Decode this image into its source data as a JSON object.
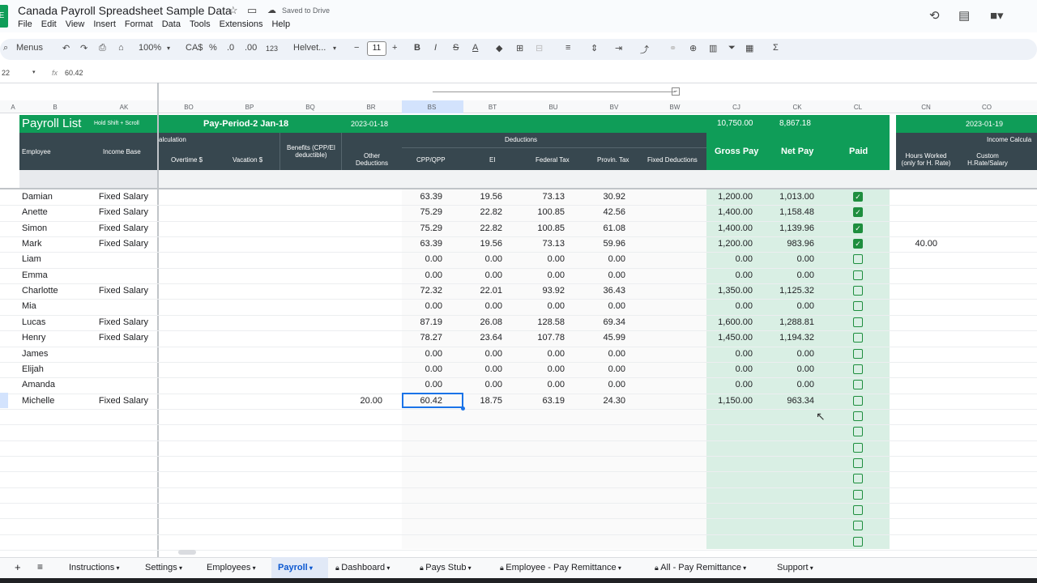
{
  "app": {
    "title": "Canada Payroll Spreadsheet Sample Data",
    "saved_status": "Saved to Drive",
    "logo_letter": "E"
  },
  "menu": [
    "File",
    "Edit",
    "View",
    "Insert",
    "Format",
    "Data",
    "Tools",
    "Extensions",
    "Help"
  ],
  "toolbar": {
    "menus_label": "Menus",
    "zoom": "100%",
    "currency": "CA$",
    "percent": "%",
    "dec_dec": ".0",
    "dec_inc": ".00",
    "number_format": "123",
    "font": "Helvet...",
    "font_size": "11",
    "bold": "B",
    "italic": "I",
    "strike": "S",
    "text_color": "A",
    "sum": "Σ"
  },
  "formula": {
    "cell_ref": "22",
    "fx": "fx",
    "value": "60.42"
  },
  "columns": [
    "A",
    "B",
    "AK",
    "BO",
    "BP",
    "BQ",
    "BR",
    "BS",
    "BT",
    "BU",
    "BV",
    "BW",
    "CJ",
    "CK",
    "CL",
    "CN",
    "CO"
  ],
  "header": {
    "payroll_list": "Payroll List",
    "hold_shift": "Hold Shift + Scroll",
    "pay_period": "Pay-Period-2 Jan-18",
    "period_date": "2023-01-18",
    "gross_total": "10,750.00",
    "net_total": "8,867.18",
    "next_date": "2023-01-19",
    "income_calc": "Income Calcula",
    "calculation": "alculation",
    "deductions": "Deductions",
    "employee": "Employee",
    "income_base": "Income Base",
    "overtime": "Overtime $",
    "vacation": "Vacation $",
    "benefits_1": "Benefits (CPP/EI",
    "benefits_2": "deductible)",
    "other_ded_1": "Other",
    "other_ded_2": "Deductions",
    "cpp": "CPP/QPP",
    "ei": "EI",
    "federal": "Federal Tax",
    "provin": "Provin. Tax",
    "fixed_ded": "Fixed Deductions",
    "gross_pay": "Gross Pay",
    "net_pay": "Net Pay",
    "paid": "Paid",
    "hours_1": "Hours Worked",
    "hours_2": "(only for H. Rate)",
    "custom_1": "Custom",
    "custom_2": "H.Rate/Salary"
  },
  "rows": [
    {
      "name": "Damian",
      "base": "Fixed Salary",
      "other": "",
      "cpp": "63.39",
      "ei": "19.56",
      "fed": "73.13",
      "prov": "30.92",
      "gross": "1,200.00",
      "net": "1,013.00",
      "paid": true,
      "hours": ""
    },
    {
      "name": "Anette",
      "base": "Fixed Salary",
      "other": "",
      "cpp": "75.29",
      "ei": "22.82",
      "fed": "100.85",
      "prov": "42.56",
      "gross": "1,400.00",
      "net": "1,158.48",
      "paid": true,
      "hours": ""
    },
    {
      "name": "Simon",
      "base": "Fixed Salary",
      "other": "",
      "cpp": "75.29",
      "ei": "22.82",
      "fed": "100.85",
      "prov": "61.08",
      "gross": "1,400.00",
      "net": "1,139.96",
      "paid": true,
      "hours": ""
    },
    {
      "name": "Mark",
      "base": "Fixed Salary",
      "other": "",
      "cpp": "63.39",
      "ei": "19.56",
      "fed": "73.13",
      "prov": "59.96",
      "gross": "1,200.00",
      "net": "983.96",
      "paid": true,
      "hours": "40.00"
    },
    {
      "name": "Liam",
      "base": "",
      "other": "",
      "cpp": "0.00",
      "ei": "0.00",
      "fed": "0.00",
      "prov": "0.00",
      "gross": "0.00",
      "net": "0.00",
      "paid": false,
      "hours": ""
    },
    {
      "name": "Emma",
      "base": "",
      "other": "",
      "cpp": "0.00",
      "ei": "0.00",
      "fed": "0.00",
      "prov": "0.00",
      "gross": "0.00",
      "net": "0.00",
      "paid": false,
      "hours": ""
    },
    {
      "name": "Charlotte",
      "base": "Fixed Salary",
      "other": "",
      "cpp": "72.32",
      "ei": "22.01",
      "fed": "93.92",
      "prov": "36.43",
      "gross": "1,350.00",
      "net": "1,125.32",
      "paid": false,
      "hours": ""
    },
    {
      "name": "Mia",
      "base": "",
      "other": "",
      "cpp": "0.00",
      "ei": "0.00",
      "fed": "0.00",
      "prov": "0.00",
      "gross": "0.00",
      "net": "0.00",
      "paid": false,
      "hours": ""
    },
    {
      "name": "Lucas",
      "base": "Fixed Salary",
      "other": "",
      "cpp": "87.19",
      "ei": "26.08",
      "fed": "128.58",
      "prov": "69.34",
      "gross": "1,600.00",
      "net": "1,288.81",
      "paid": false,
      "hours": ""
    },
    {
      "name": "Henry",
      "base": "Fixed Salary",
      "other": "",
      "cpp": "78.27",
      "ei": "23.64",
      "fed": "107.78",
      "prov": "45.99",
      "gross": "1,450.00",
      "net": "1,194.32",
      "paid": false,
      "hours": ""
    },
    {
      "name": "James",
      "base": "",
      "other": "",
      "cpp": "0.00",
      "ei": "0.00",
      "fed": "0.00",
      "prov": "0.00",
      "gross": "0.00",
      "net": "0.00",
      "paid": false,
      "hours": ""
    },
    {
      "name": "Elijah",
      "base": "",
      "other": "",
      "cpp": "0.00",
      "ei": "0.00",
      "fed": "0.00",
      "prov": "0.00",
      "gross": "0.00",
      "net": "0.00",
      "paid": false,
      "hours": ""
    },
    {
      "name": "Amanda",
      "base": "",
      "other": "",
      "cpp": "0.00",
      "ei": "0.00",
      "fed": "0.00",
      "prov": "0.00",
      "gross": "0.00",
      "net": "0.00",
      "paid": false,
      "hours": ""
    },
    {
      "name": "Michelle",
      "base": "Fixed Salary",
      "other": "20.00",
      "cpp": "60.42",
      "ei": "18.75",
      "fed": "63.19",
      "prov": "24.30",
      "gross": "1,150.00",
      "net": "963.34",
      "paid": false,
      "hours": ""
    }
  ],
  "extra_checkboxes": 9,
  "sheet_tabs": [
    {
      "label": "Instructions",
      "locked": false,
      "active": false
    },
    {
      "label": "Settings",
      "locked": false,
      "active": false
    },
    {
      "label": "Employees",
      "locked": false,
      "active": false
    },
    {
      "label": "Payroll",
      "locked": false,
      "active": true
    },
    {
      "label": "Dashboard",
      "locked": true,
      "active": false
    },
    {
      "label": "Pays Stub",
      "locked": true,
      "active": false
    },
    {
      "label": "Employee - Pay Remittance",
      "locked": true,
      "active": false
    },
    {
      "label": "All - Pay Remittance",
      "locked": true,
      "active": false
    },
    {
      "label": "Support",
      "locked": false,
      "active": false
    }
  ],
  "colors": {
    "green": "#0f9d58",
    "dark": "#37474f",
    "light_green": "#d9efe4",
    "selection": "#1a73e8"
  }
}
